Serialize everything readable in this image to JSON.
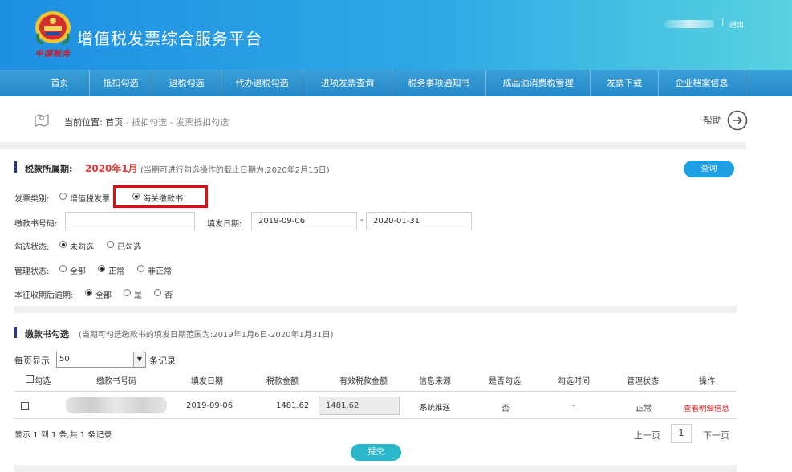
{
  "header": {
    "title": "增值税发票综合服务平台",
    "brand_signature": "中国税务",
    "separator": "|",
    "logout_label": "退出",
    "emblem_icon": "tax-emblem-icon"
  },
  "nav": {
    "items": [
      {
        "label": "首页"
      },
      {
        "label": "抵扣勾选"
      },
      {
        "label": "退税勾选"
      },
      {
        "label": "代办退税勾选"
      },
      {
        "label": "进项发票查询"
      },
      {
        "label": "税务事项通知书"
      },
      {
        "label": "成品油消费税管理"
      },
      {
        "label": "发票下载"
      },
      {
        "label": "企业档案信息"
      }
    ]
  },
  "breadcrumb": {
    "prefix": "当前位置:",
    "home": "首页",
    "trail": "- 抵扣勾选 - 发票抵扣勾选",
    "help_label": "帮助"
  },
  "period": {
    "label": "税款所属期:",
    "value": "2020年1月",
    "note": "(当期可进行勾选操作的截止日期为:2020年2月15日)",
    "query_button": "查询"
  },
  "form": {
    "invoice_type": {
      "label": "发票类别:",
      "options": [
        "增值税发票",
        "海关缴款书"
      ],
      "selected": 1
    },
    "payment_no": {
      "label": "缴款书号码:",
      "value": ""
    },
    "issue_date": {
      "label": "填发日期:",
      "from": "2019-09-06",
      "dash": "-",
      "to": "2020-01-31"
    },
    "check_status": {
      "label": "勾选状态:",
      "options": [
        "未勾选",
        "已勾选"
      ],
      "selected": 0
    },
    "manage_status": {
      "label": "管理状态:",
      "options": [
        "全部",
        "正常",
        "非正常"
      ],
      "selected": 1
    },
    "overdue": {
      "label": "本征收期后逾期:",
      "options": [
        "全部",
        "是",
        "否"
      ],
      "selected": 0
    }
  },
  "list": {
    "title": "缴款书勾选",
    "note": "(当期可勾选缴款书的填发日期范围为:2019年1月6日-2020年1月31日)",
    "per_page_prefix": "每页显示",
    "per_page_value": "50",
    "per_page_suffix": "条记录",
    "columns": [
      "勾选",
      "缴款书号码",
      "填发日期",
      "税款金额",
      "有效税款金额",
      "信息来源",
      "是否勾选",
      "勾选时间",
      "管理状态",
      "操作"
    ],
    "rows": [
      {
        "issue_date": "2019-09-06",
        "tax_amount": "1481.62",
        "effective_amount": "1481.62",
        "source": "系统推送",
        "checked": "否",
        "check_time": "-",
        "status": "正常",
        "action": "查看明细信息"
      }
    ],
    "summary": "显示 1 到 1 条,共 1 条记录",
    "pager": {
      "prev": "上一页",
      "current": "1",
      "next": "下一页"
    },
    "submit_button": "提交"
  }
}
